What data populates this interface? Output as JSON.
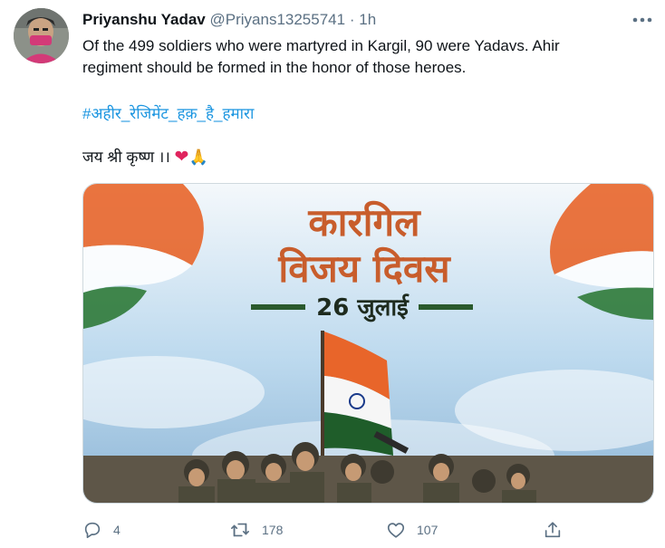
{
  "tweet": {
    "author_name": "Priyanshu Yadav",
    "handle": "@Priyans13255741",
    "separator": "·",
    "time": "1h",
    "text_line1": "Of the 499 soldiers who were martyred in Kargil, 90 were Yadavs.  Ahir",
    "text_line2": "regiment should be formed in the honor of those heroes.",
    "hashtag": "#अहीर_रेजिमेंट_हक़_है_हमारा",
    "closing_text": "जय श्री कृष्ण ।। ",
    "closing_emoji_heart": "❤",
    "closing_emoji_pray": "🙏"
  },
  "media": {
    "title_line1": "कारगिल",
    "title_line2": "विजय दिवस",
    "date": "26 जुलाई"
  },
  "actions": {
    "reply_count": "4",
    "retweet_count": "178",
    "like_count": "107"
  },
  "colors": {
    "link": "#1b95e0",
    "secondary_text": "#5b7083",
    "poster_title": "#c85d2c",
    "poster_date_band": "#2a5a2d"
  },
  "icons": [
    "avatar",
    "more-icon",
    "reply-icon",
    "retweet-icon",
    "like-icon",
    "share-icon"
  ]
}
